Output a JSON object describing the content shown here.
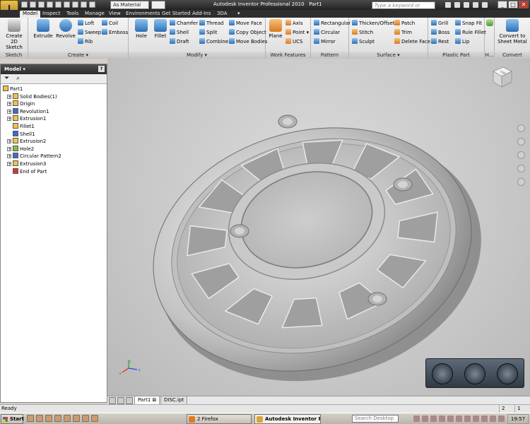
{
  "window": {
    "app_title": "Autodesk Inventor Professional 2010",
    "doc_title": "Part1",
    "app_button_label": "I",
    "material": "As Material",
    "search_placeholder": "Type a keyword or phrase"
  },
  "ribbon_tabs": [
    "Model",
    "Inspect",
    "Tools",
    "Manage",
    "View",
    "Environments",
    "Get Started",
    "Add-Ins",
    "3DA"
  ],
  "ribbon": {
    "sketch": {
      "label": "Sketch",
      "create_2d_sketch_line1": "Create",
      "create_2d_sketch_line2": "2D Sketch"
    },
    "create": {
      "label": "Create",
      "extrude": "Extrude",
      "revolve": "Revolve",
      "loft": "Loft",
      "sweep": "Sweep",
      "rib": "Rib",
      "coil": "Coil",
      "emboss": "Emboss"
    },
    "modify": {
      "label": "Modify",
      "hole": "Hole",
      "fillet": "Fillet",
      "chamfer": "Chamfer",
      "shell": "Shell",
      "draft": "Draft",
      "thread": "Thread",
      "split": "Split",
      "combine": "Combine",
      "move_face": "Move Face",
      "copy_object": "Copy Object",
      "move_bodies": "Move Bodies"
    },
    "work_features": {
      "label": "Work Features",
      "plane": "Plane",
      "axis": "Axis",
      "point": "Point",
      "ucs": "UCS"
    },
    "pattern": {
      "label": "Pattern",
      "rectangular": "Rectangular",
      "circular": "Circular",
      "mirror": "Mirror"
    },
    "surface": {
      "label": "Surface",
      "thicken_offset": "Thicken/Offset",
      "stitch": "Stitch",
      "sculpt": "Sculpt",
      "patch": "Patch",
      "trim": "Trim",
      "delete_face": "Delete Face"
    },
    "plastic_part": {
      "label": "Plastic Part",
      "grill": "Grill",
      "boss": "Boss",
      "rest": "Rest",
      "snap_fit": "Snap Fit",
      "rule_fillet": "Rule Fillet",
      "lip": "Lip"
    },
    "harness": {
      "label": "H..."
    },
    "convert": {
      "label": "Convert",
      "btn_line1": "Convert to",
      "btn_line2": "Sheet Metal"
    }
  },
  "browser": {
    "title": "Model",
    "help": "?",
    "filter_icon": "filter-icon",
    "find_icon": "binoculars-icon",
    "tree": [
      {
        "label": "Part1",
        "indent": 0,
        "icon_color": "#f2c24a",
        "expand": ""
      },
      {
        "label": "Solid Bodies(1)",
        "indent": 1,
        "icon_color": "#f2c24a",
        "expand": "+"
      },
      {
        "label": "Origin",
        "indent": 1,
        "icon_color": "#f2c24a",
        "expand": "+"
      },
      {
        "label": "Revolution1",
        "indent": 1,
        "icon_color": "#3a6fc4",
        "expand": "+"
      },
      {
        "label": "Extrusion1",
        "indent": 1,
        "icon_color": "#f2c24a",
        "expand": "+"
      },
      {
        "label": "Fillet1",
        "indent": 1,
        "icon_color": "#f2c24a",
        "expand": ""
      },
      {
        "label": "Shell1",
        "indent": 1,
        "icon_color": "#3a6fc4",
        "expand": ""
      },
      {
        "label": "Extrusion2",
        "indent": 1,
        "icon_color": "#f2c24a",
        "expand": "+"
      },
      {
        "label": "Hole2",
        "indent": 1,
        "icon_color": "#8bbf3a",
        "expand": "+"
      },
      {
        "label": "Circular Pattern2",
        "indent": 1,
        "icon_color": "#3a6fc4",
        "expand": "+"
      },
      {
        "label": "Extrusion3",
        "indent": 1,
        "icon_color": "#f2c24a",
        "expand": "+"
      },
      {
        "label": "End of Part",
        "indent": 1,
        "icon_color": "#d9372b",
        "expand": ""
      }
    ]
  },
  "viewcube": {
    "face": "TOP"
  },
  "doc_tabs": [
    "Part1",
    "DISC.ipt"
  ],
  "status": {
    "text": "Ready",
    "box1": "2",
    "box2": "1"
  },
  "taskbar": {
    "start": "Start",
    "firefox": "2 Firefox",
    "inventor": "Autodesk Inventor Pr...",
    "search": "Search Desktop",
    "time": "19:57"
  },
  "colors": {
    "ribbon_accent": "#2f6eb5",
    "titlebar": "#2b2b2b",
    "model_gray": "#c8c8c8"
  }
}
